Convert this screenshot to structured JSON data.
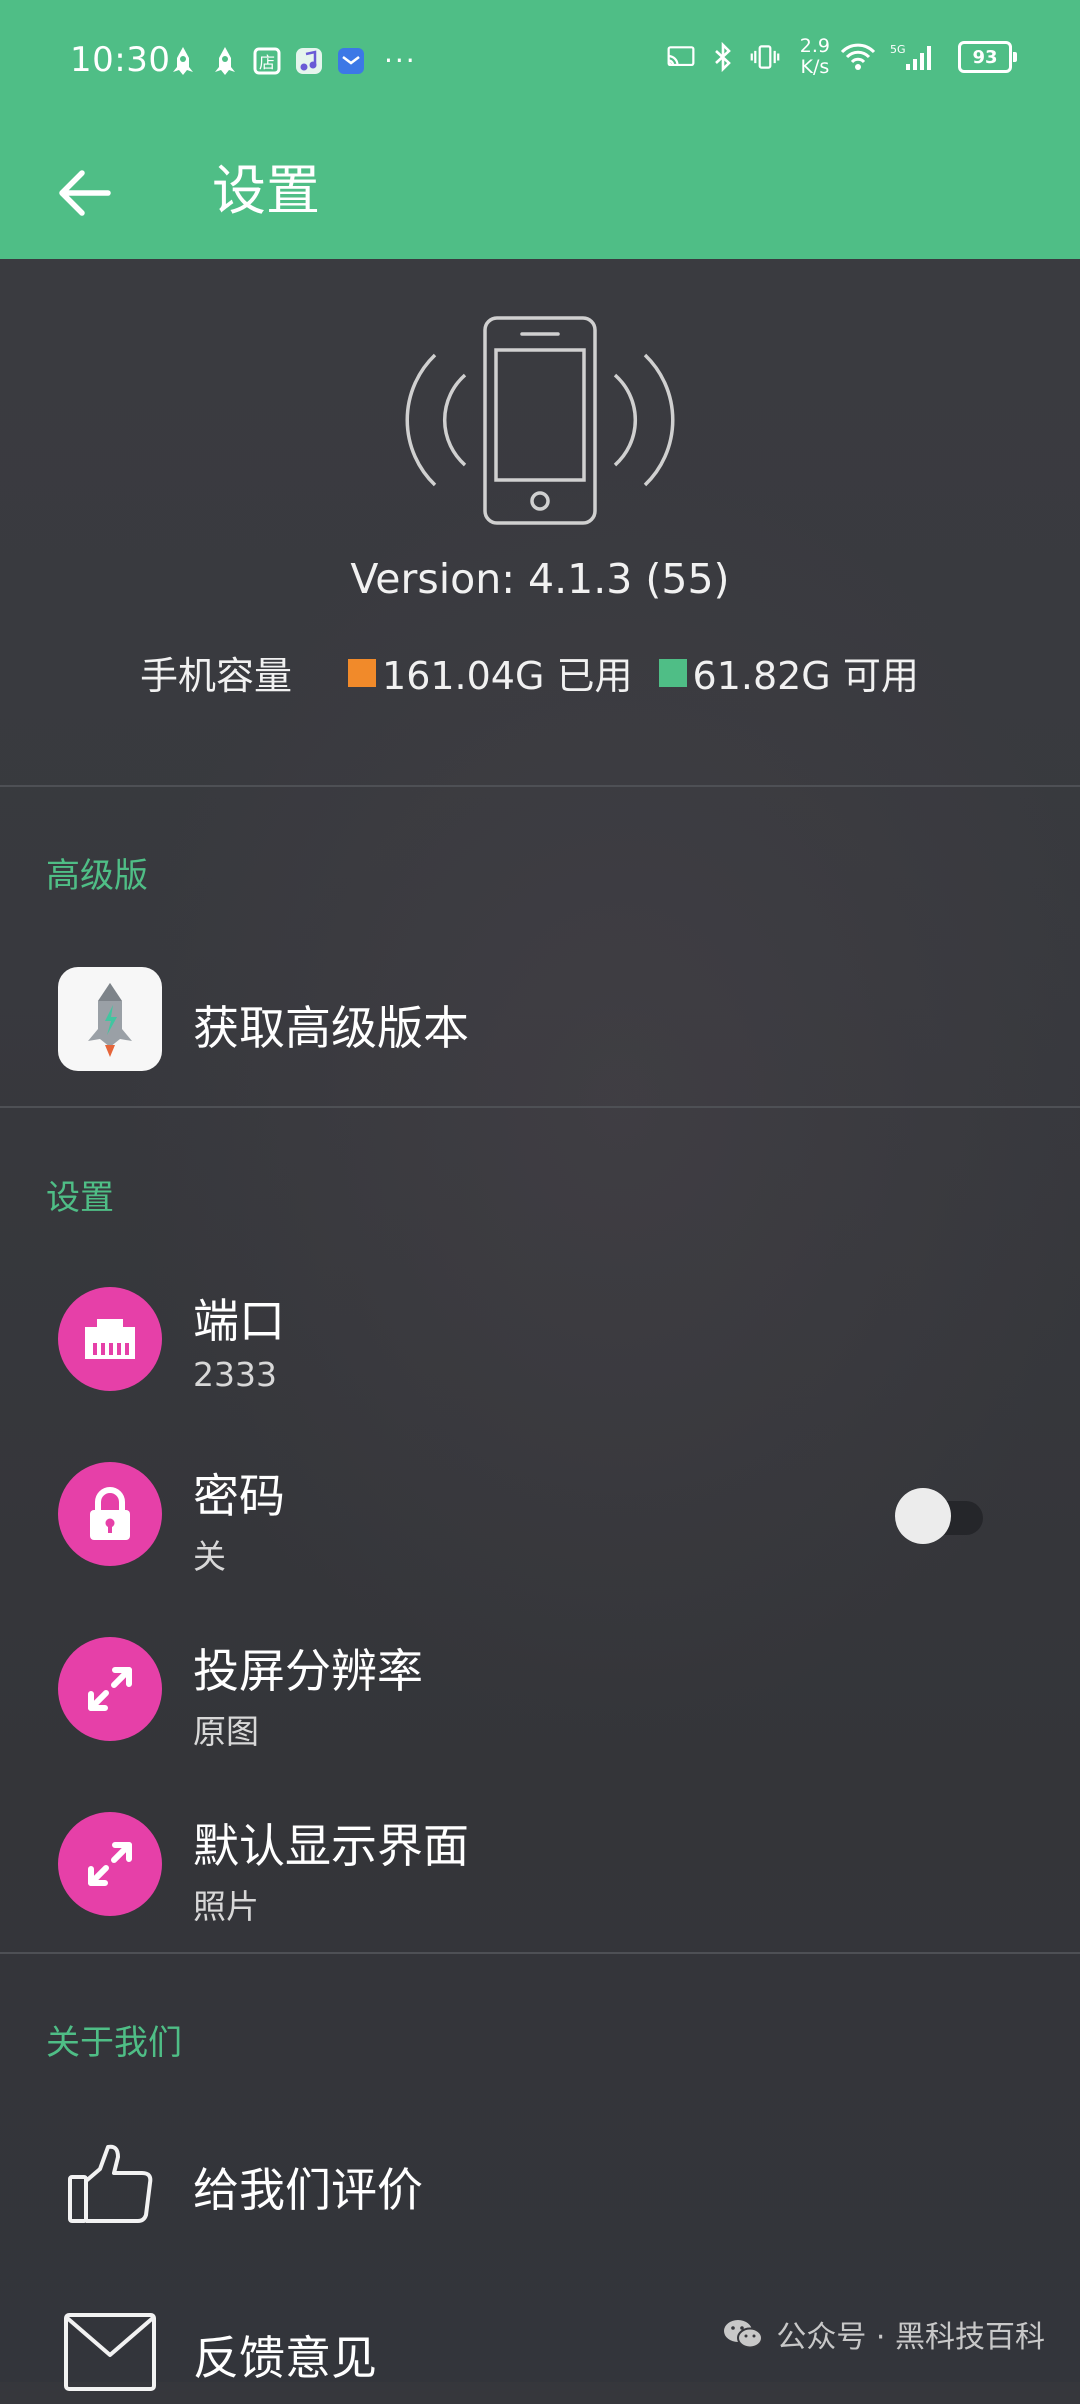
{
  "status_bar": {
    "time": "10:30",
    "left_icons": [
      "app-rocket-icon",
      "app-rocket-icon",
      "store-icon",
      "music-icon",
      "mail-app-icon"
    ],
    "more": "···",
    "network_speed_value": "2.9",
    "network_speed_unit": "K/s",
    "signal_label": "5G",
    "battery": "93"
  },
  "app_bar": {
    "title": "设置",
    "color": "#4fbe86"
  },
  "device_info": {
    "version": "Version: 4.1.3 (55)",
    "capacity_label": "手机容量",
    "used": "161.04G 已用",
    "available": "61.82G 可用",
    "used_color": "#f18a2a",
    "available_color": "#4fbe86"
  },
  "sections": {
    "premium": {
      "title": "高级版",
      "item_title": "获取高级版本"
    },
    "settings": {
      "title": "设置",
      "port": {
        "title": "端口",
        "value": "2333"
      },
      "password": {
        "title": "密码",
        "value": "关",
        "enabled": false
      },
      "resolution": {
        "title": "投屏分辨率",
        "value": "原图"
      },
      "default_view": {
        "title": "默认显示界面",
        "value": "照片"
      }
    },
    "about": {
      "title": "关于我们",
      "rate": "给我们评价",
      "feedback": "反馈意见"
    }
  },
  "watermark": {
    "text": "公众号 · 黑科技百科"
  },
  "colors": {
    "accent": "#4fbe86",
    "icon_pink": "#e640a8",
    "background": "#36373c"
  }
}
